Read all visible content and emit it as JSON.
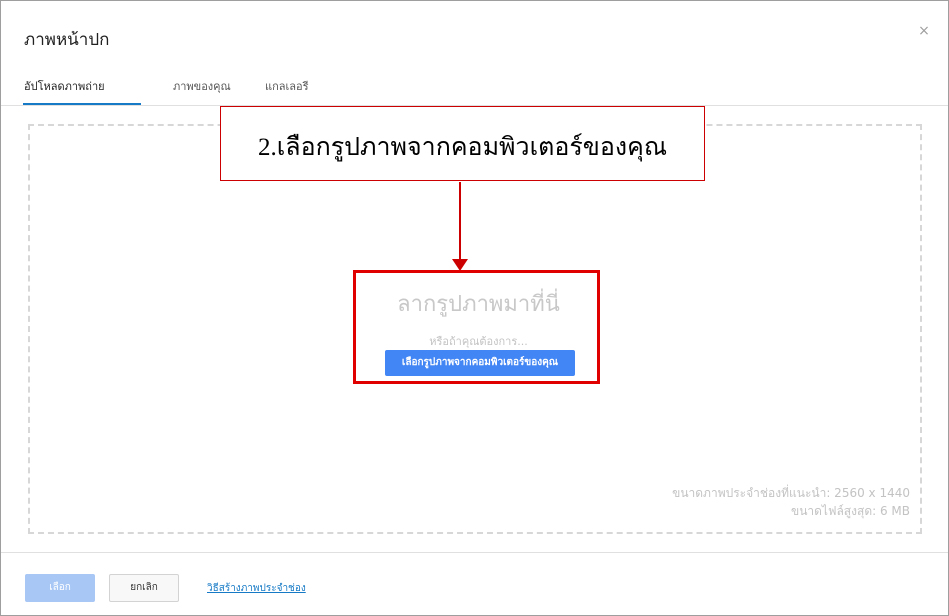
{
  "dialog": {
    "title": "ภาพหน้าปก",
    "close_label": "×"
  },
  "tabs": [
    {
      "label": "อัปโหลดภาพถ่าย",
      "active": true
    },
    {
      "label": "ภาพของคุณ",
      "active": false
    },
    {
      "label": "แกลเลอรี",
      "active": false
    }
  ],
  "dropzone": {
    "title": "ลากรูปภาพมาที่นี่",
    "or_text": "หรือถ้าคุณต้องการ...",
    "pick_button": "เลือกรูปภาพจากคอมพิวเตอร์ของคุณ",
    "hint_size": "ขนาดภาพประจำช่องที่แนะนำ: 2560 x 1440",
    "hint_max": "ขนาดไฟล์สูงสุด: 6 MB"
  },
  "annotation": {
    "text": "2.เลือกรูปภาพจากคอมพิวเตอร์ของคุณ",
    "color": "#cc0000"
  },
  "footer": {
    "select_button": "เลือก",
    "cancel_button": "ยกเลิก",
    "help_link": "วิธีสร้างภาพประจำช่อง"
  },
  "colors": {
    "accent": "#4285f4",
    "link": "#167ac6"
  }
}
